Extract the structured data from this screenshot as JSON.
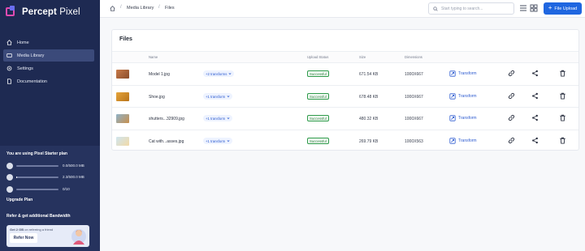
{
  "sidebar": {
    "brand_bold": "Percept",
    "brand_thin": "Pixel",
    "nav": [
      {
        "label": "Home",
        "icon": "home-icon"
      },
      {
        "label": "Media Library",
        "icon": "folder-icon"
      },
      {
        "label": "Settings",
        "icon": "gear-icon"
      },
      {
        "label": "Documentation",
        "icon": "document-icon"
      }
    ],
    "plan_title": "You are using Pixel Starter plan",
    "usage": [
      {
        "icon": "cloud-icon",
        "value": "0.0/500.0 MB",
        "fraction": 0.0
      },
      {
        "icon": "gauge-icon",
        "value": "2.3/500.0 MB",
        "fraction": 0.005
      },
      {
        "icon": "image-icon",
        "value": "0/10",
        "fraction": 0.0
      }
    ],
    "upgrade_label": "Upgrade Plan",
    "refer_title": "Refer & get additional Bandwidth",
    "refer_text_bold": "Get 2 GB",
    "refer_text_rest": " on referring a friend",
    "refer_button": "Refer Now"
  },
  "topbar": {
    "breadcrumb": [
      "Media Library",
      "Files"
    ],
    "search_placeholder": "Start typing to search...",
    "upload_label": "File Upload"
  },
  "files": {
    "title": "Files",
    "columns": [
      "Name",
      "Upload Status",
      "Size",
      "Dimensions"
    ],
    "rows": [
      {
        "name": "Model 1.jpg",
        "transforms": "+2 transforms",
        "status": "Successful",
        "size": "671.54 KB",
        "dimensions": "1000X667",
        "action": "Transform",
        "thumb_colors": [
          "#c97b4a",
          "#8a4d2b"
        ]
      },
      {
        "name": "Shoe.jpg",
        "transforms": "+1 transform",
        "status": "Successful",
        "size": "678.48 KB",
        "dimensions": "1000X667",
        "action": "Transform",
        "thumb_colors": [
          "#e6a53b",
          "#b8731a"
        ]
      },
      {
        "name": "shutters...32909.jpg",
        "transforms": "+1 transform",
        "status": "Successful",
        "size": "480.32 KB",
        "dimensions": "1000X667",
        "action": "Transform",
        "thumb_colors": [
          "#8fb3c9",
          "#c88f4d"
        ]
      },
      {
        "name": "Cat with...asses.jpg",
        "transforms": "+1 transform",
        "status": "Successful",
        "size": "269.79 KB",
        "dimensions": "1000X563",
        "action": "Transform",
        "thumb_colors": [
          "#cfe6f0",
          "#f2d9a6"
        ]
      }
    ]
  },
  "colors": {
    "sidebar": "#1e2a52",
    "accent": "#1f66e0",
    "success": "#2e9a4a"
  }
}
